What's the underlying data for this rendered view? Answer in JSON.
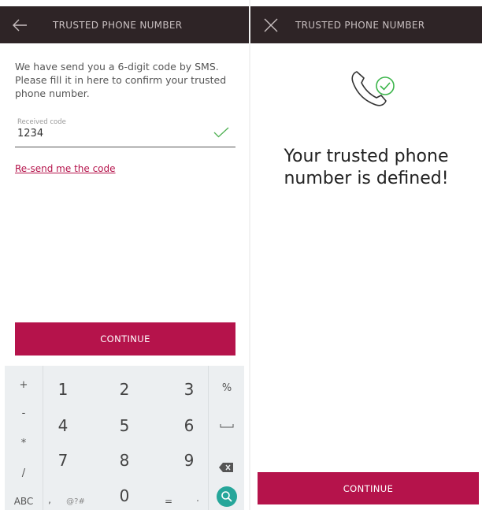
{
  "left_screen": {
    "header_title": "TRUSTED PHONE NUMBER",
    "instructions": "We have send you a 6-digit code by SMS. Please fill it in here to confirm your trusted phone number.",
    "code_field": {
      "label": "Received code",
      "value": "1234"
    },
    "resend_link": "Re-send me the code",
    "continue_label": "CONTINUE"
  },
  "keyboard": {
    "symbol_keys": [
      "+",
      "-",
      "*",
      "/"
    ],
    "digits": [
      "1",
      "2",
      "3",
      "4",
      "5",
      "6",
      "7",
      "8",
      "9",
      "0"
    ],
    "abc_label": "ABC",
    "comma": ",",
    "special_label": "@?#",
    "equals": "=",
    "dot": ".",
    "percent": "%",
    "icons": [
      "space-icon",
      "backspace-icon",
      "search-icon"
    ],
    "accent_color": "#26a69a"
  },
  "right_screen": {
    "header_title": "TRUSTED PHONE NUMBER",
    "success_message": "Your trusted phone number is defined!",
    "continue_label": "CONTINUE"
  },
  "colors": {
    "header_bg": "#2e2426",
    "primary": "#b5134b",
    "success": "#3bb54a"
  }
}
